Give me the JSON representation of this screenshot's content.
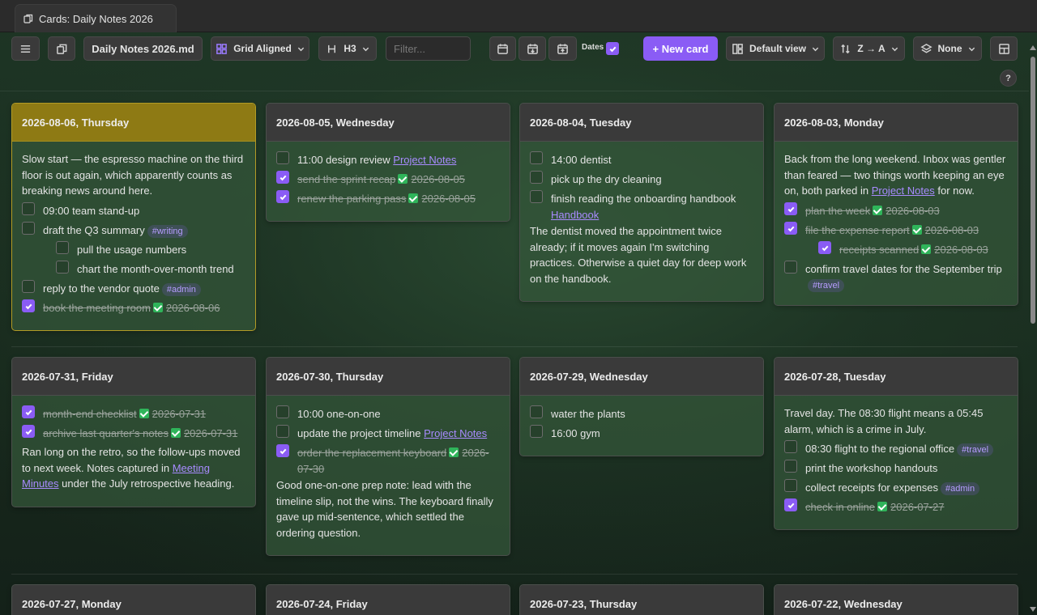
{
  "tab": {
    "title": "Cards: Daily Notes 2026"
  },
  "toolbar": {
    "file_name": "Daily Notes 2026.md",
    "layout": "Grid Aligned",
    "heading": "H3",
    "filter_placeholder": "Filter...",
    "dates_label": "Dates",
    "dates_checked": true,
    "new_card": "+ New card",
    "view": "Default view",
    "sort": "Z → A",
    "group": "None",
    "help": "?"
  },
  "colors": {
    "accent": "#8a5cf5",
    "today_header": "#8e7a14",
    "done_check": "#2fb45a"
  },
  "cards": [
    {
      "title": "2026-08-06, Thursday",
      "today": true,
      "content": [
        {
          "type": "para",
          "text": "Slow start — the espresso machine on the third floor is out again, which apparently counts as breaking news around here."
        },
        {
          "type": "task",
          "text": "09:00 team stand-up"
        },
        {
          "type": "task",
          "text": "draft the Q3 summary",
          "tag": "#writing"
        },
        {
          "type": "task",
          "text": "pull the usage numbers",
          "sub": true
        },
        {
          "type": "task",
          "text": "chart the month-over-month trend",
          "sub": true
        },
        {
          "type": "task",
          "text": "reply to the vendor quote",
          "tag": "#admin"
        },
        {
          "type": "task",
          "text": "book the meeting room",
          "done": true,
          "date": "2026-08-06"
        }
      ]
    },
    {
      "title": "2026-08-05, Wednesday",
      "content": [
        {
          "type": "task",
          "text": "11:00 design review",
          "link": "Project Notes"
        },
        {
          "type": "task",
          "text": "send the sprint recap",
          "done": true,
          "date": "2026-08-05"
        },
        {
          "type": "task",
          "text": "renew the parking pass",
          "done": true,
          "date": "2026-08-05"
        }
      ]
    },
    {
      "title": "2026-08-04, Tuesday",
      "content": [
        {
          "type": "task",
          "text": "14:00 dentist"
        },
        {
          "type": "task",
          "text": "pick up the dry cleaning"
        },
        {
          "type": "task",
          "text": "finish reading the onboarding handbook",
          "link": "Handbook"
        },
        {
          "type": "para",
          "text": "The dentist moved the appointment twice already; if it moves again I'm switching practices. Otherwise a quiet day for deep work on the handbook."
        }
      ]
    },
    {
      "title": "2026-08-03, Monday",
      "content": [
        {
          "type": "para",
          "pre": "Back from the long weekend. Inbox was gentler than feared — two things worth keeping an eye on, both parked in ",
          "link": "Project Notes",
          "post": " for now."
        },
        {
          "type": "task",
          "text": "plan the week",
          "done": true,
          "date": "2026-08-03"
        },
        {
          "type": "task",
          "text": "file the expense report",
          "done": true,
          "date": "2026-08-03"
        },
        {
          "type": "task",
          "text": "receipts scanned",
          "done": true,
          "date": "2026-08-03",
          "sub": true
        },
        {
          "type": "task",
          "text": "confirm travel dates for the September trip",
          "tag": "#travel"
        }
      ]
    },
    {
      "title": "2026-07-31, Friday",
      "content": [
        {
          "type": "task",
          "text": "month-end checklist",
          "done": true,
          "date": "2026-07-31"
        },
        {
          "type": "task",
          "text": "archive last quarter's notes",
          "done": true,
          "date": "2026-07-31"
        },
        {
          "type": "para",
          "pre": "Ran long on the retro, so the follow-ups moved to next week. Notes captured in ",
          "link": "Meeting Minutes",
          "post": " under the July retrospective heading."
        }
      ]
    },
    {
      "title": "2026-07-30, Thursday",
      "content": [
        {
          "type": "task",
          "text": "10:00 one-on-one"
        },
        {
          "type": "task",
          "text": "update the project timeline",
          "link": "Project Notes"
        },
        {
          "type": "task",
          "text": "order the replacement keyboard",
          "done": true,
          "date": "2026-07-30"
        },
        {
          "type": "para",
          "text": "Good one-on-one prep note: lead with the timeline slip, not the wins. The keyboard finally gave up mid-sentence, which settled the ordering question."
        }
      ]
    },
    {
      "title": "2026-07-29, Wednesday",
      "content": [
        {
          "type": "task",
          "text": "water the plants"
        },
        {
          "type": "task",
          "text": "16:00 gym"
        }
      ]
    },
    {
      "title": "2026-07-28, Tuesday",
      "content": [
        {
          "type": "para",
          "text": "Travel day. The 08:30 flight means a 05:45 alarm, which is a crime in July."
        },
        {
          "type": "task",
          "text": "08:30 flight to the regional office",
          "tag": "#travel"
        },
        {
          "type": "task",
          "text": "print the workshop handouts"
        },
        {
          "type": "task",
          "text": "collect receipts for expenses",
          "tag": "#admin"
        },
        {
          "type": "task",
          "text": "check in online",
          "done": true,
          "date": "2026-07-27"
        }
      ]
    },
    {
      "title": "2026-07-27, Monday",
      "content": []
    },
    {
      "title": "2026-07-24, Friday",
      "content": []
    },
    {
      "title": "2026-07-23, Thursday",
      "content": []
    },
    {
      "title": "2026-07-22, Wednesday",
      "content": []
    }
  ]
}
